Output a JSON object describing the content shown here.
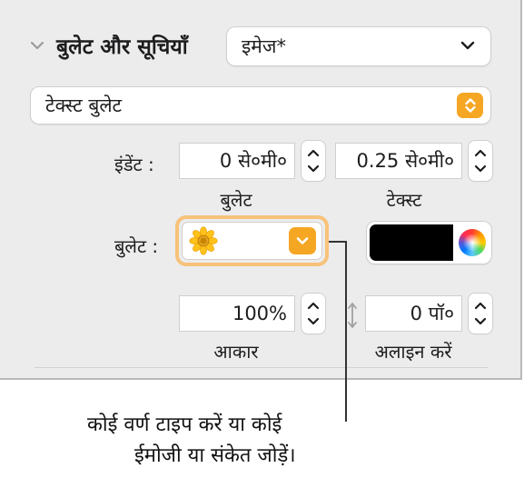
{
  "section": {
    "title": "बुलेट और सूचियाँ",
    "style_popup_value": "इमेज*",
    "list_type_value": "टेक्स्ट बुलेट"
  },
  "indent": {
    "label": "इंडेंट :",
    "bullet_value": "0 से०मी०",
    "bullet_caption": "बुलेट",
    "text_value": "0.25 से०मी०",
    "text_caption": "टेक्स्ट"
  },
  "bullet": {
    "label": "बुलेट :",
    "image_icon": "sunflower-icon",
    "color_hex": "#000000"
  },
  "size": {
    "value": "100%",
    "caption": "आकार"
  },
  "align": {
    "value": "0 पॉ०",
    "caption": "अलाइन करें"
  },
  "callout": {
    "line1": "कोई वर्ण टाइप करें या कोई",
    "line2": "ईमोजी या संकेत जोड़ें।"
  },
  "colors": {
    "accent": "#f5a623",
    "panel_bg": "#ececec"
  }
}
